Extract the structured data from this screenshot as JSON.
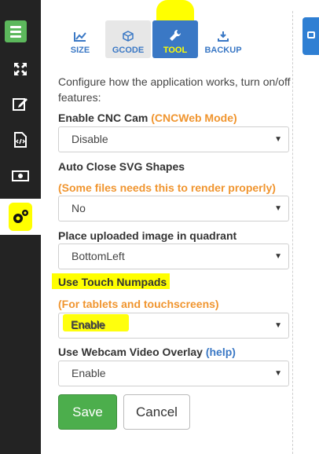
{
  "tabs": [
    {
      "label": "SIZE",
      "icon": "chart-icon"
    },
    {
      "label": "GCODE",
      "icon": "cube-icon"
    },
    {
      "label": "TOOL",
      "icon": "wrench-icon"
    },
    {
      "label": "BACKUP",
      "icon": "download-icon"
    }
  ],
  "description": "Configure how the application works, turn on/off features:",
  "settings": {
    "cnc_cam": {
      "label": "Enable CNC Cam",
      "note": "(CNCWeb Mode)",
      "value": "Disable"
    },
    "auto_close": {
      "label": "Auto Close SVG Shapes",
      "note": "(Some files needs this to render properly)",
      "value": "No"
    },
    "quadrant": {
      "label": "Place uploaded image in quadrant",
      "value": "BottomLeft"
    },
    "touch": {
      "label": "Use Touch Numpads",
      "note": "(For tablets and touchscreens)",
      "value": "Enable"
    },
    "webcam": {
      "label": "Use Webcam Video Overlay",
      "help": "(help)",
      "value": "Enable"
    }
  },
  "buttons": {
    "save": "Save",
    "cancel": "Cancel"
  },
  "sidebar": [
    "menu-icon",
    "expand-icon",
    "edit-icon",
    "code-file-icon",
    "money-icon",
    "settings-icon"
  ],
  "colors": {
    "sidebar": "#232323",
    "accent": "#3a78c5",
    "note": "#f0952f",
    "save": "#4cae4c",
    "highlight": "#ffff00"
  }
}
